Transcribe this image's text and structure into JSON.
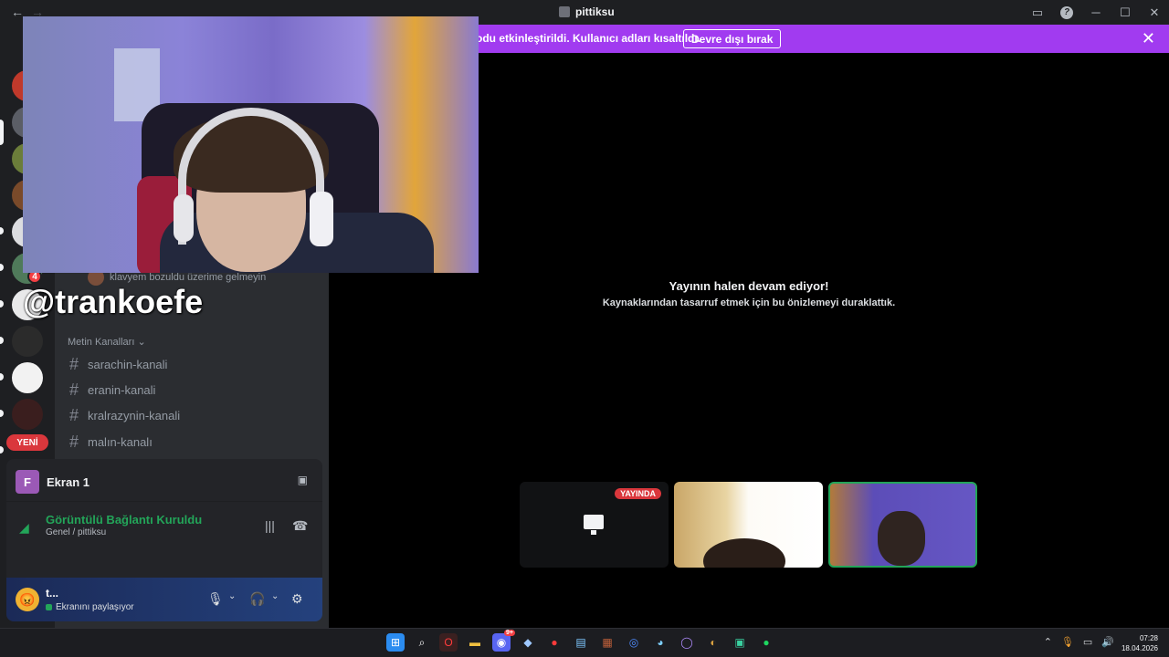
{
  "window": {
    "title": "pittiksu"
  },
  "banner": {
    "text": "odu etkinleştirildi. Kullanıcı adları kısaltıldı.",
    "button_label": "Devre dışı bırak"
  },
  "rail": {
    "badge_count": "4",
    "new_label": "YENİ"
  },
  "overlay": {
    "handle": "@trankoefe"
  },
  "channels": {
    "voice_peek_text": "klavyem bozuldu üzerime gelmeyin",
    "section_label": "Metin Kanalları",
    "items": [
      {
        "name": "sarachin-kanali"
      },
      {
        "name": "eranin-kanali"
      },
      {
        "name": "kralrazynin-kanali"
      },
      {
        "name": "malın-kanalı"
      }
    ]
  },
  "stream_panel": {
    "initial": "F",
    "label": "Ekran 1"
  },
  "voice": {
    "status": "Görüntülü Bağlantı Kuruldu",
    "location": "Genel / pittiksu"
  },
  "user": {
    "name": "t...",
    "status": "Ekranını paylaşıyor"
  },
  "stage": {
    "title": "Yayının halen devam ediyor!",
    "subtitle": "Kaynaklarından tasarruf etmek için bu önizlemeyi duraklattık.",
    "live_label": "YAYINDA"
  },
  "taskbar": {
    "notification_badge": "9+",
    "time": "07:28",
    "date": "18.04.2026"
  },
  "colors": {
    "banner": "#a13bf0",
    "connected_green": "#23a559",
    "live_red": "#da373c"
  }
}
